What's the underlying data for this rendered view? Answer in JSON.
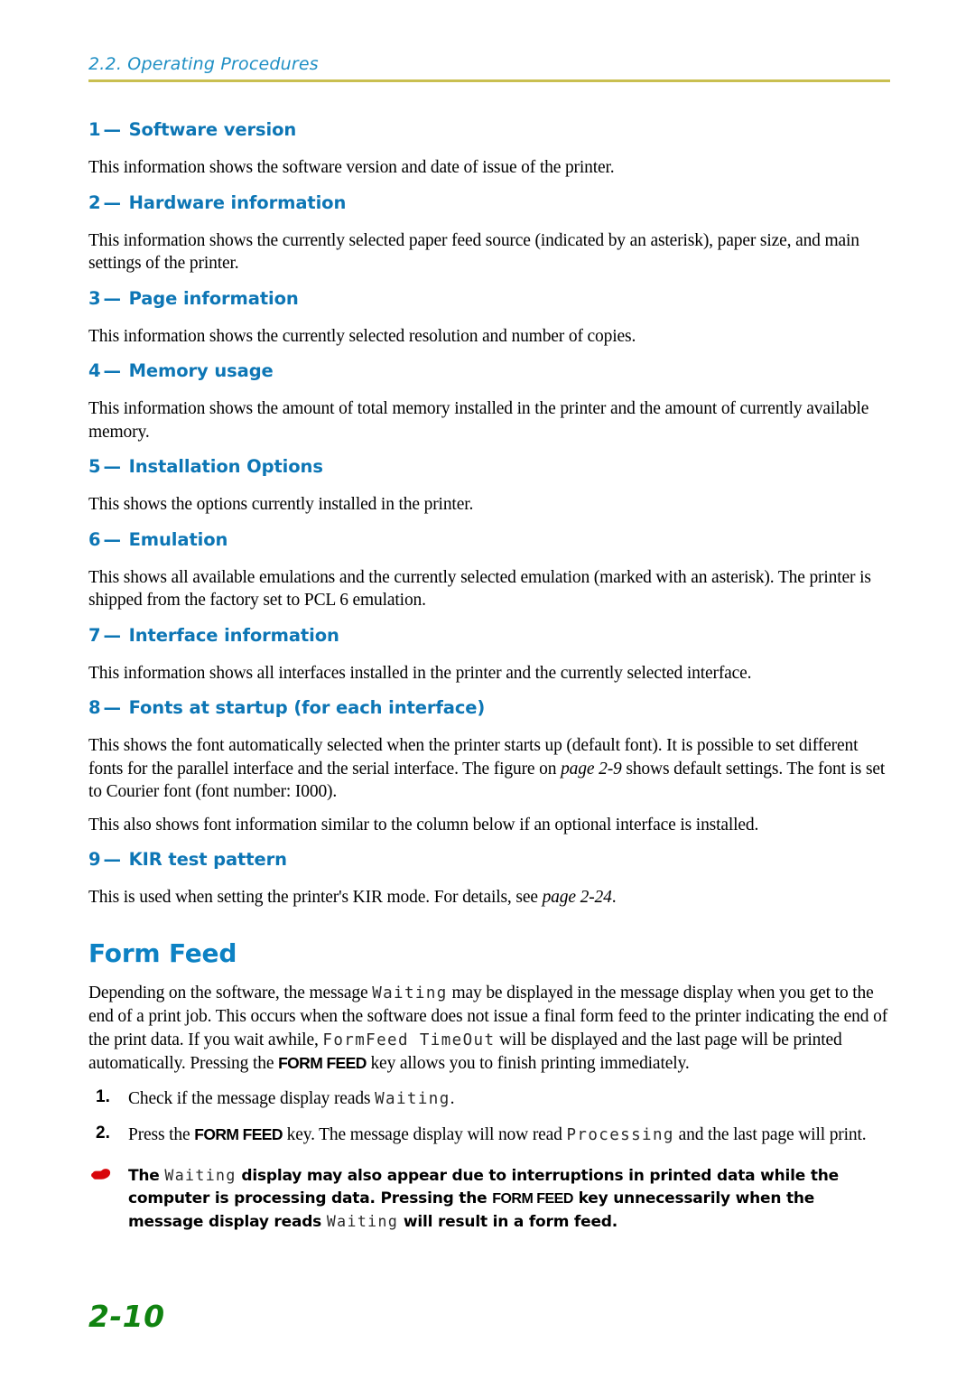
{
  "header": {
    "running_title": "2.2. Operating Procedures",
    "rule_color": "#c9bf50",
    "text_color": "#1f8fc4"
  },
  "theme": {
    "heading_blue": "#0d76b5",
    "big_heading_blue": "#0d82c4",
    "note_icon_red": "#d8060a",
    "folio_green": "#108310"
  },
  "sections": [
    {
      "number": "1",
      "dash": "—",
      "title": "Software version",
      "paragraphs": [
        "This information shows the software version and date of issue of the printer."
      ]
    },
    {
      "number": "2",
      "dash": "—",
      "title": "Hardware information",
      "paragraphs": [
        "This information shows the currently selected paper feed source (indicated by an asterisk), paper size, and main settings of the printer."
      ]
    },
    {
      "number": "3",
      "dash": "—",
      "title": "Page information",
      "paragraphs": [
        "This information shows the currently selected resolution and number of copies."
      ]
    },
    {
      "number": "4",
      "dash": "—",
      "title": "Memory usage",
      "paragraphs": [
        "This information shows the amount of total memory installed in the printer and the amount of currently available memory."
      ]
    },
    {
      "number": "5",
      "dash": "—",
      "title": "Installation Options",
      "paragraphs": [
        "This shows the options currently installed in the printer."
      ]
    },
    {
      "number": "6",
      "dash": "—",
      "title": "Emulation",
      "paragraphs": [
        "This shows all available emulations and the currently selected emulation (marked with an asterisk). The printer is shipped from the factory set to PCL 6 emulation."
      ]
    },
    {
      "number": "7",
      "dash": "—",
      "title": "Interface information",
      "paragraphs": [
        "This information shows all interfaces installed in the printer and the currently selected interface."
      ]
    },
    {
      "number": "8",
      "dash": "—",
      "title": "Fonts at startup (for each interface)",
      "paragraphs": []
    },
    {
      "number": "9",
      "dash": "—",
      "title": "KIR test pattern",
      "paragraphs": []
    }
  ],
  "section8": {
    "p1_a": "This shows the font automatically selected when the printer starts up (default font). It is possible to set different fonts for the parallel interface and the serial interface. The figure on ",
    "p1_ref": "page 2-9",
    "p1_b": " shows default settings. The font is set to Courier font (font number: I000).",
    "p2": "This also shows font information similar to the column below if an optional interface is installed."
  },
  "section9": {
    "p1_a": "This is used when setting the printer's KIR mode. For details, see ",
    "p1_ref": "page 2-24",
    "p1_b": "."
  },
  "form_feed": {
    "title": "Form Feed",
    "intro_a": "Depending on the software, the message ",
    "intro_msg1": "Waiting",
    "intro_b": " may be displayed in the message display when you get to the end of a print job.  This occurs when the software does not issue a final form feed to the printer indicating the end of the print data.  If you wait awhile, ",
    "intro_msg2": "FormFeed TimeOut",
    "intro_c": " will be displayed and the last page will be printed automatically.  Pressing the ",
    "intro_key": "FORM FEED",
    "intro_d": " key allows you to finish printing immediately.",
    "steps": [
      {
        "number": "1.",
        "text_a": "Check if the message display reads ",
        "msg": "Waiting",
        "text_b": "."
      },
      {
        "number": "2.",
        "text_a": "Press the ",
        "key": "FORM FEED",
        "text_b": " key.  The message display will now read ",
        "msg": "Processing",
        "text_c": " and the last page will print."
      }
    ],
    "note": {
      "icon": "pointing-hand-icon",
      "icon_glyph": "☞",
      "text_a": "The ",
      "msg1": "Waiting",
      "text_b": " display may also appear due to interruptions in printed data while the computer is processing data.  Pressing the ",
      "key": "FORM FEED",
      "text_c": " key unnecessarily when the message display reads ",
      "msg2": "Waiting",
      "text_d": " will result in a form feed."
    }
  },
  "folio": {
    "page_number": "2-10"
  }
}
